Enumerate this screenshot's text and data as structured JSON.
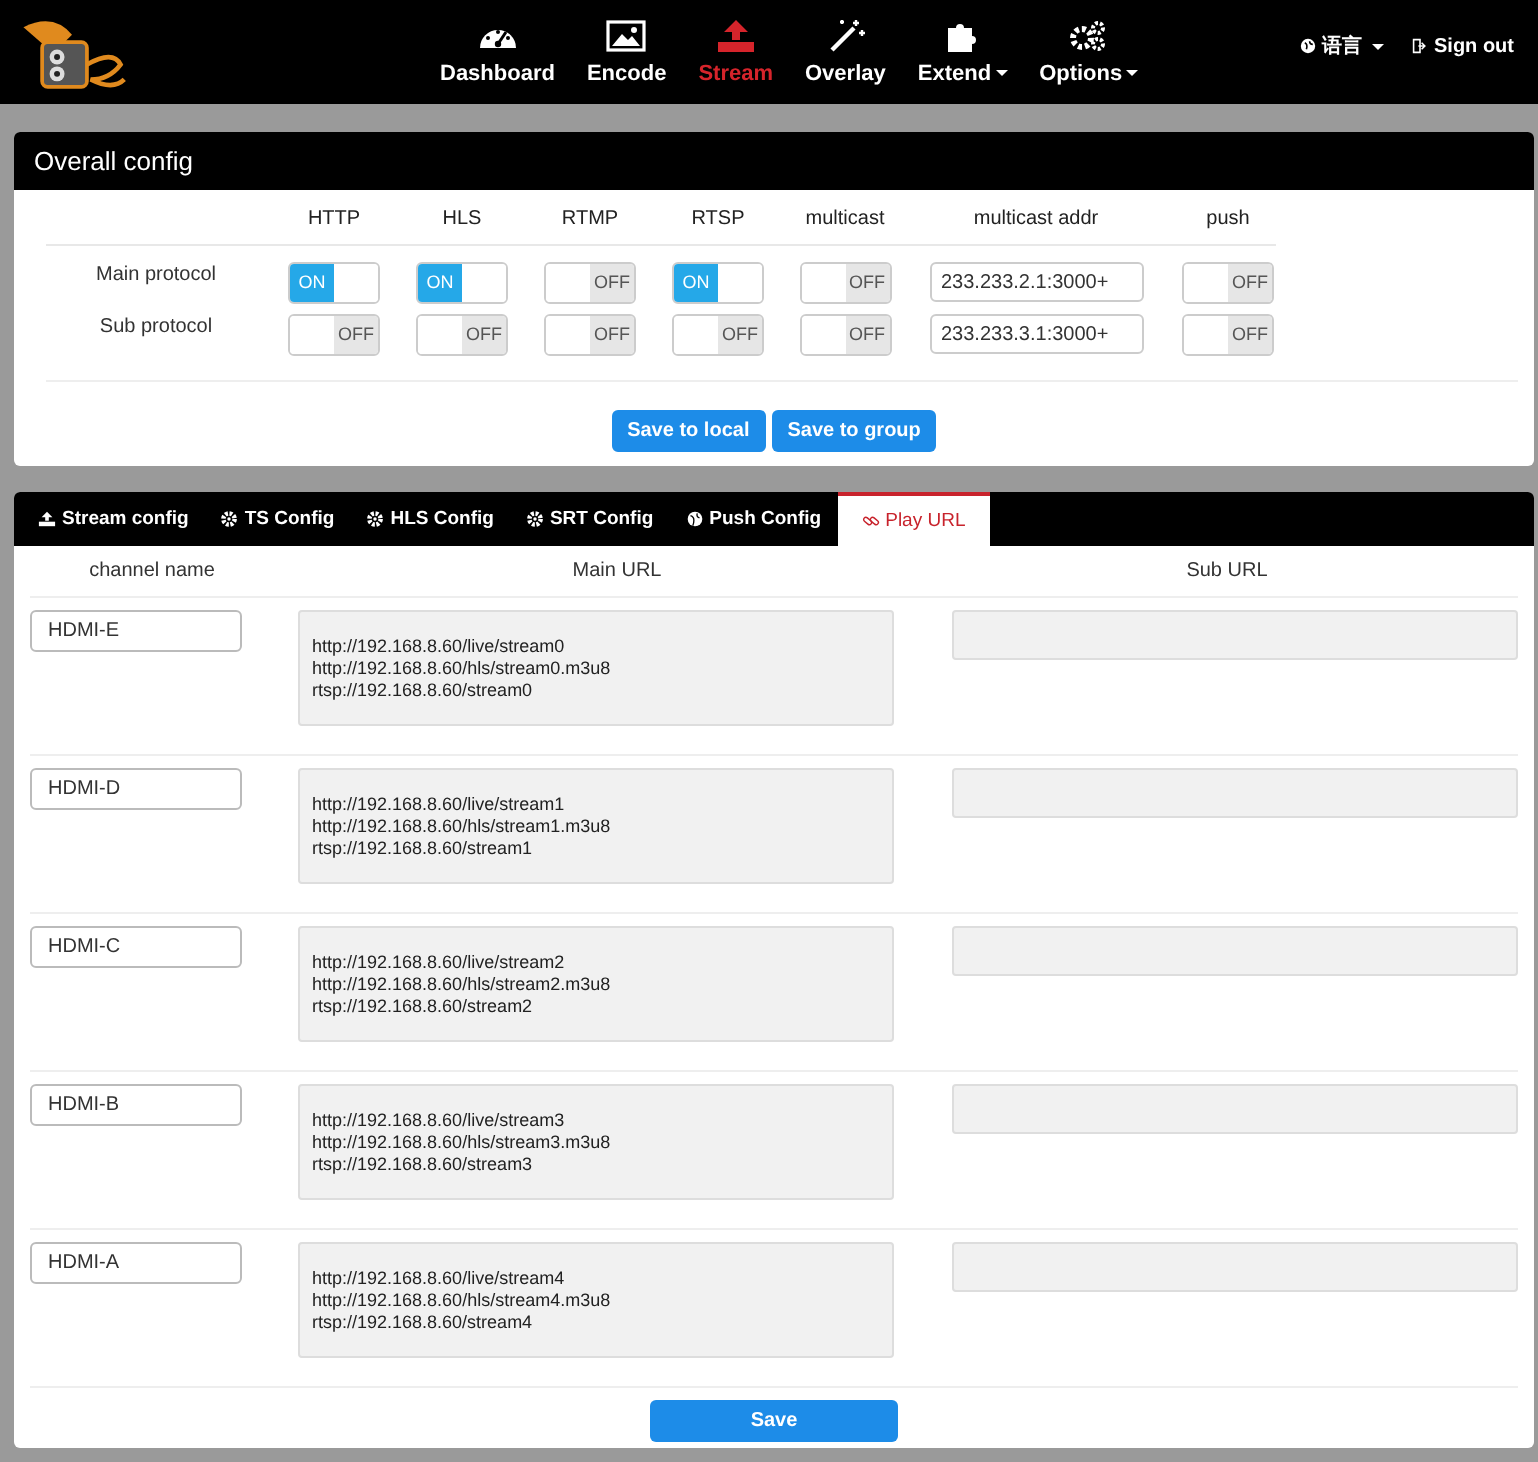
{
  "nav": {
    "items": [
      {
        "label": "Dashboard",
        "kind": "gauge",
        "dropdown": false,
        "selected": false
      },
      {
        "label": "Encode",
        "kind": "image",
        "dropdown": false,
        "selected": false
      },
      {
        "label": "Stream",
        "kind": "upload",
        "dropdown": false,
        "selected": true
      },
      {
        "label": "Overlay",
        "kind": "wand",
        "dropdown": false,
        "selected": false
      },
      {
        "label": "Extend",
        "kind": "puzzle",
        "dropdown": true,
        "selected": false
      },
      {
        "label": "Options",
        "kind": "gears",
        "dropdown": true,
        "selected": false
      }
    ],
    "language": "语言",
    "sign_out": "Sign out"
  },
  "overall": {
    "title": "Overall config",
    "columns": [
      "HTTP",
      "HLS",
      "RTMP",
      "RTSP",
      "multicast",
      "multicast addr",
      "push"
    ],
    "rows": [
      {
        "label": "Main protocol",
        "switches": [
          {
            "on": true,
            "text": "ON"
          },
          {
            "on": true,
            "text": "ON"
          },
          {
            "on": false,
            "text": "OFF"
          },
          {
            "on": true,
            "text": "ON"
          },
          {
            "on": false,
            "text": "OFF"
          }
        ],
        "addr": "233.233.2.1:3000+",
        "push": {
          "on": false,
          "text": "OFF"
        }
      },
      {
        "label": "Sub protocol",
        "switches": [
          {
            "on": false,
            "text": "OFF"
          },
          {
            "on": false,
            "text": "OFF"
          },
          {
            "on": false,
            "text": "OFF"
          },
          {
            "on": false,
            "text": "OFF"
          },
          {
            "on": false,
            "text": "OFF"
          }
        ],
        "addr": "233.233.3.1:3000+",
        "push": {
          "on": false,
          "text": "OFF"
        }
      }
    ],
    "buttons": [
      "Save to local",
      "Save to group"
    ]
  },
  "tabs": [
    {
      "label": "Stream config",
      "kind": "upload",
      "selected": false
    },
    {
      "label": "TS Config",
      "kind": "gear",
      "selected": false
    },
    {
      "label": "HLS Config",
      "kind": "gear",
      "selected": false
    },
    {
      "label": "SRT Config",
      "kind": "gear",
      "selected": false
    },
    {
      "label": "Push Config",
      "kind": "globe",
      "selected": false
    },
    {
      "label": "Play URL",
      "kind": "link",
      "selected": true
    }
  ],
  "table": {
    "columns": [
      "channel name",
      "Main URL",
      "Sub URL"
    ],
    "rows": [
      {
        "name": "HDMI-E",
        "main": [
          "http://192.168.8.60/live/stream0",
          "http://192.168.8.60/hls/stream0.m3u8",
          "rtsp://192.168.8.60/stream0"
        ]
      },
      {
        "name": "HDMI-D",
        "main": [
          "http://192.168.8.60/live/stream1",
          "http://192.168.8.60/hls/stream1.m3u8",
          "rtsp://192.168.8.60/stream1"
        ]
      },
      {
        "name": "HDMI-C",
        "main": [
          "http://192.168.8.60/live/stream2",
          "http://192.168.8.60/hls/stream2.m3u8",
          "rtsp://192.168.8.60/stream2"
        ]
      },
      {
        "name": "HDMI-B",
        "main": [
          "http://192.168.8.60/live/stream3",
          "http://192.168.8.60/hls/stream3.m3u8",
          "rtsp://192.168.8.60/stream3"
        ]
      },
      {
        "name": "HDMI-A",
        "main": [
          "http://192.168.8.60/live/stream4",
          "http://192.168.8.60/hls/stream4.m3u8",
          "rtsp://192.168.8.60/stream4"
        ]
      }
    ]
  },
  "save": "Save"
}
